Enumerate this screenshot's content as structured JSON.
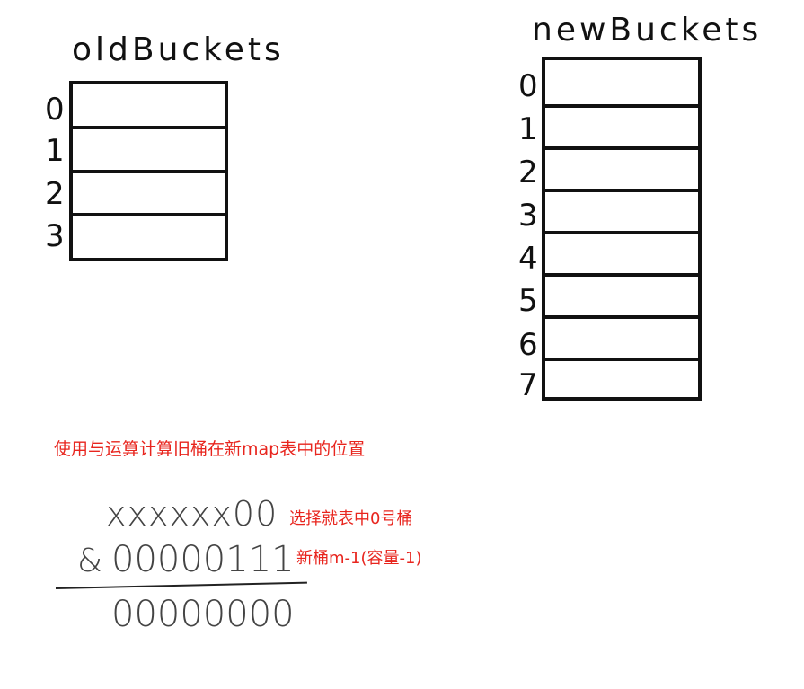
{
  "old_buckets": {
    "title": "oldBuckets",
    "indices": [
      "0",
      "1",
      "2",
      "3"
    ]
  },
  "new_buckets": {
    "title": "newBuckets",
    "indices": [
      "0",
      "1",
      "2",
      "3",
      "4",
      "5",
      "6",
      "7"
    ]
  },
  "caption": "使用与运算计算旧桶在新map表中的位置",
  "calculation": {
    "operand_a": "xxxxxx00",
    "operator": "&",
    "operand_b": "00000111",
    "result": "00000000",
    "note_a": "选择就表中0号桶",
    "note_b": "新桶m-1(容量-1)"
  },
  "colors": {
    "ink": "#111111",
    "annotation": "#e8251e",
    "calc_text": "#444444"
  }
}
